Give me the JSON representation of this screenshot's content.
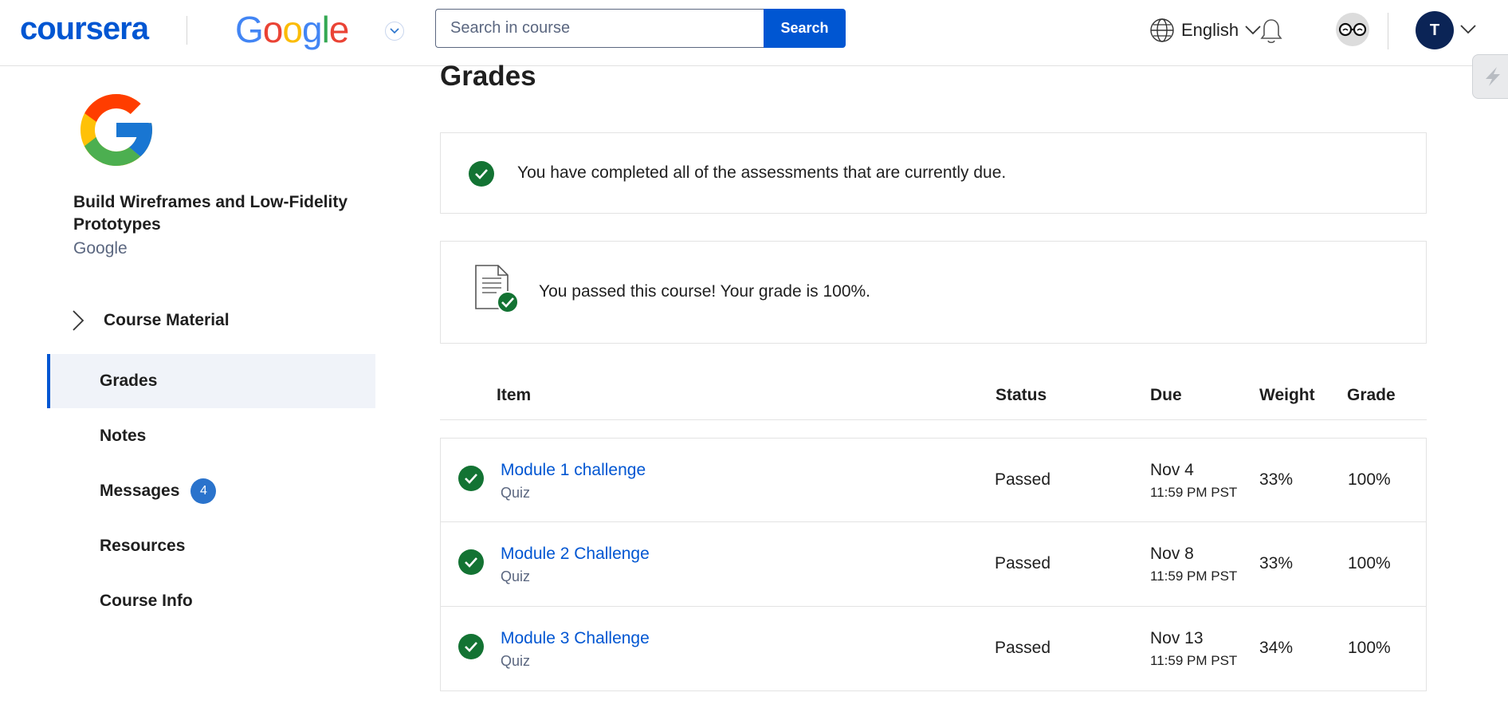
{
  "header": {
    "brand": "coursera",
    "partner": "Google",
    "search_placeholder": "Search in course",
    "search_button": "Search",
    "language": "English",
    "user_initial": "T"
  },
  "sidebar": {
    "course_title": "Build Wireframes and Low-Fidelity Prototypes",
    "course_org": "Google",
    "course_material": "Course Material",
    "items": [
      {
        "label": "Grades",
        "active": true
      },
      {
        "label": "Notes"
      },
      {
        "label": "Messages",
        "badge": "4"
      },
      {
        "label": "Resources"
      },
      {
        "label": "Course Info"
      }
    ]
  },
  "main": {
    "title": "Grades",
    "completed_message": "You have completed all of the assessments that are currently due.",
    "passed_message": "You passed this course! Your grade is 100%.",
    "columns": {
      "item": "Item",
      "status": "Status",
      "due": "Due",
      "weight": "Weight",
      "grade": "Grade"
    },
    "rows": [
      {
        "name": "Module 1 challenge",
        "type": "Quiz",
        "status": "Passed",
        "due": "Nov 4",
        "due_time": "11:59 PM PST",
        "weight": "33%",
        "grade": "100%"
      },
      {
        "name": "Module 2 Challenge",
        "type": "Quiz",
        "status": "Passed",
        "due": "Nov 8",
        "due_time": "11:59 PM PST",
        "weight": "33%",
        "grade": "100%"
      },
      {
        "name": "Module 3 Challenge",
        "type": "Quiz",
        "status": "Passed",
        "due": "Nov 13",
        "due_time": "11:59 PM PST",
        "weight": "34%",
        "grade": "100%"
      }
    ]
  },
  "colors": {
    "brand_blue": "#0056d2",
    "success_green": "#137333",
    "badge_blue": "#2a73cc"
  }
}
